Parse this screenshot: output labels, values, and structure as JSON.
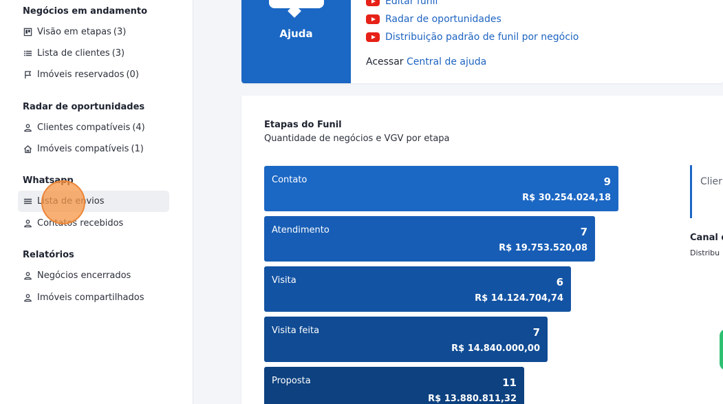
{
  "sidebar": {
    "sections": [
      {
        "title": "Negócios em andamento"
      },
      {
        "title": "Radar de oportunidades"
      },
      {
        "title": "Whatsapp"
      },
      {
        "title": "Relatórios"
      }
    ],
    "items": [
      {
        "label": "Visão em etapas",
        "count": "(3)",
        "icon": "kanban-icon"
      },
      {
        "label": "Lista de clientes",
        "count": "(3)",
        "icon": "list-icon"
      },
      {
        "label": "Imóveis reservados",
        "count": "(0)",
        "icon": "flag-icon"
      },
      {
        "label": "Clientes compatíveis",
        "count": "(4)",
        "icon": "person-icon"
      },
      {
        "label": "Imóveis compatíveis",
        "count": "(1)",
        "icon": "home-icon"
      },
      {
        "label": "Lista de envios",
        "count": "",
        "icon": "list-icon"
      },
      {
        "label": "Contatos recebidos",
        "count": "",
        "icon": "person-icon"
      },
      {
        "label": "Negócios encerrados",
        "count": "",
        "icon": "person-icon"
      },
      {
        "label": "Imóveis compartilhados",
        "count": "",
        "icon": "person-icon"
      }
    ]
  },
  "help": {
    "label": "Ajuda",
    "links": [
      "Editar funil",
      "Radar de oportunidades",
      "Distribuição padrão de funil por negócio"
    ],
    "access_prefix": "Acessar",
    "access_link": "Central de ajuda"
  },
  "funnel": {
    "title": "Etapas do Funil",
    "subtitle": "Quantidade de negócios e VGV por etapa",
    "stages": [
      {
        "name": "Contato",
        "count": "9",
        "vgv": "R$ 30.254.024,18",
        "color": "#1b67c4"
      },
      {
        "name": "Atendimento",
        "count": "7",
        "vgv": "R$ 19.753.520,08",
        "color": "#175db5"
      },
      {
        "name": "Visita",
        "count": "6",
        "vgv": "R$ 14.124.704,74",
        "color": "#1353a3"
      },
      {
        "name": "Visita feita",
        "count": "7",
        "vgv": "R$ 14.840.000,00",
        "color": "#104b93"
      },
      {
        "name": "Proposta",
        "count": "11",
        "vgv": "R$ 13.880.811,32",
        "color": "#0d4180"
      }
    ]
  },
  "right_panel": {
    "box_text": "Clier",
    "canal_title": "Canal d",
    "canal_sub": "Distribu"
  }
}
